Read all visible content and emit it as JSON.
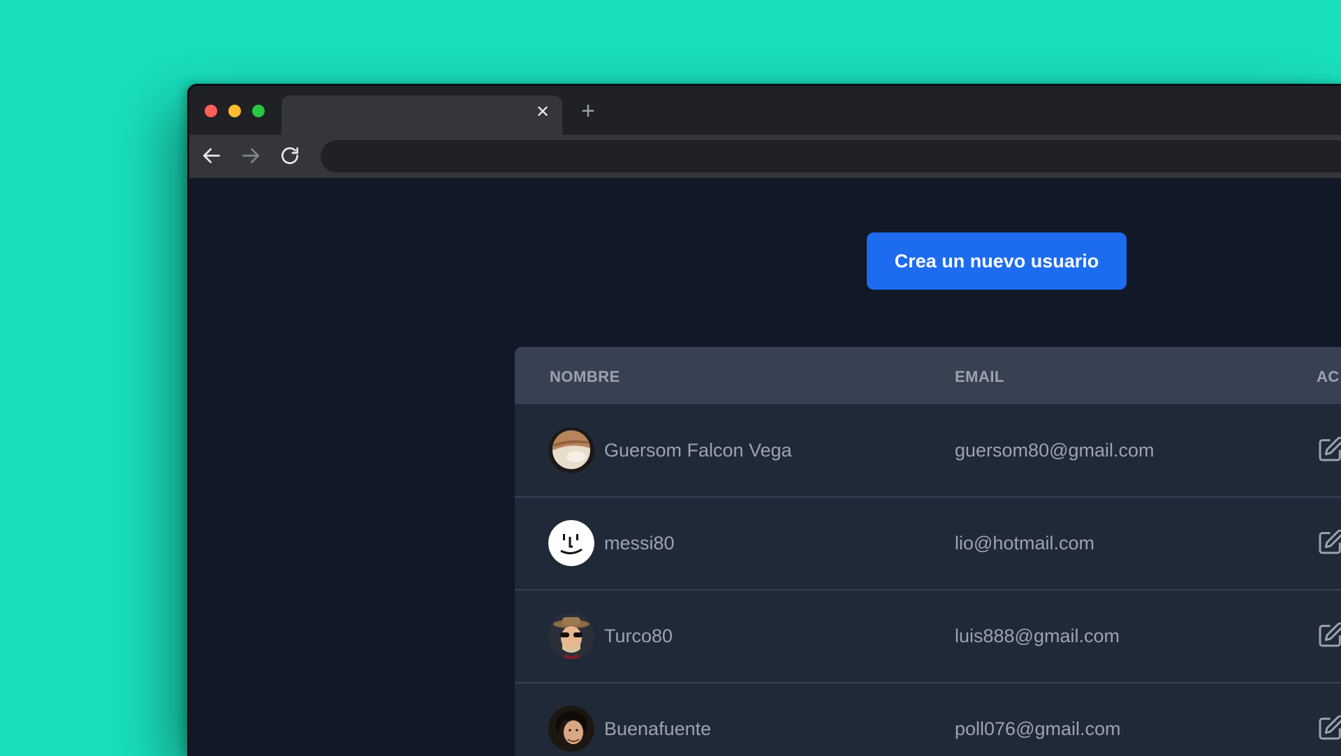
{
  "browser": {
    "tab": {
      "title": "",
      "close_icon": "close-icon"
    },
    "new_tab_icon": "plus-icon",
    "nav": {
      "back_icon": "arrow-left-icon",
      "forward_icon": "arrow-right-icon",
      "reload_icon": "reload-icon"
    },
    "address": ""
  },
  "page": {
    "create_button_label": "Crea un nuevo usuario",
    "table": {
      "headers": {
        "name": "NOMBRE",
        "email": "EMAIL",
        "actions": "AC"
      },
      "rows": [
        {
          "name": "Guersom Falcon Vega",
          "email": "guersom80@gmail.com",
          "avatar": "planet-avatar"
        },
        {
          "name": "messi80",
          "email": "lio@hotmail.com",
          "avatar": "smiley-avatar"
        },
        {
          "name": "Turco80",
          "email": "luis888@gmail.com",
          "avatar": "hat-sunglasses-avatar"
        },
        {
          "name": "Buenafuente",
          "email": "poll076@gmail.com",
          "avatar": "person-photo-avatar"
        }
      ],
      "row_action_icon": "edit-icon"
    }
  },
  "colors": {
    "background": "#19dfbb",
    "primary_button": "#1d6cf0",
    "page_bg": "#111827",
    "table_bg": "#1f2937",
    "table_header_bg": "#374151",
    "text_muted": "#9ca3af"
  }
}
